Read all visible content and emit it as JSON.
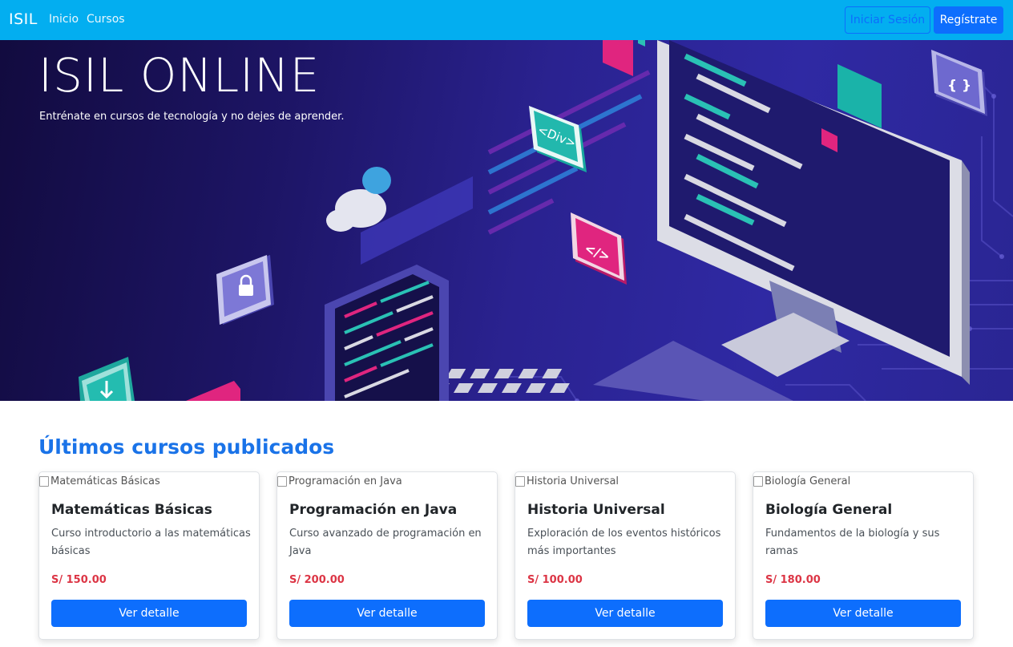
{
  "navbar": {
    "brand": "ISIL",
    "links": [
      "Inicio",
      "Cursos"
    ],
    "login_label": "Iniciar Sesión",
    "register_label": "Regístrate"
  },
  "hero": {
    "title": "ISIL ONLINE",
    "subtitle": "Entrénate en cursos de tecnología y no dejes de aprender.",
    "illustration_labels": [
      "<Div>",
      "</>",
      "{ }"
    ]
  },
  "section": {
    "title": "Últimos cursos publicados"
  },
  "courses": [
    {
      "image_alt": "Matemáticas Básicas",
      "title": "Matemáticas Básicas",
      "description": "Curso introductorio a las matemáticas básicas",
      "price": "S/ 150.00",
      "button": "Ver detalle"
    },
    {
      "image_alt": "Programación en Java",
      "title": "Programación en Java",
      "description": "Curso avanzado de programación en Java",
      "price": "S/ 200.00",
      "button": "Ver detalle"
    },
    {
      "image_alt": "Historia Universal",
      "title": "Historia Universal",
      "description": "Exploración de los eventos históricos más importantes",
      "price": "S/ 100.00",
      "button": "Ver detalle"
    },
    {
      "image_alt": "Biología General",
      "title": "Biología General",
      "description": "Fundamentos de la biología y sus ramas",
      "price": "S/ 180.00",
      "button": "Ver detalle"
    }
  ],
  "colors": {
    "navbar": "#03aef0",
    "primary": "#0d6efd",
    "price": "#dc3545",
    "section_title": "#1a73e8"
  }
}
